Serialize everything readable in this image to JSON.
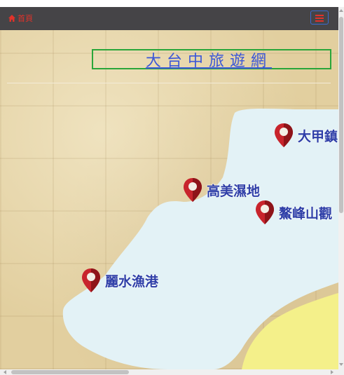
{
  "navbar": {
    "home_label": "首頁",
    "home_icon": "home-icon",
    "menu_icon": "hamburger-menu-icon"
  },
  "header": {
    "title": "大台中旅遊網"
  },
  "map": {
    "colors": {
      "land": "#e2cf9f",
      "sea": "#e3f2f6",
      "island": "#f4f08a",
      "label": "#2f3fa8",
      "pin": "#c8242c"
    },
    "markers": [
      {
        "label": "大甲鎮",
        "icon": "map-pin-icon"
      },
      {
        "label": "高美濕地",
        "icon": "map-pin-icon"
      },
      {
        "label": "鰲峰山觀",
        "icon": "map-pin-icon"
      },
      {
        "label": "麗水漁港",
        "icon": "map-pin-icon"
      }
    ]
  },
  "colors": {
    "navbar_bg": "#454447",
    "accent_red": "#e0322a",
    "title_border": "#2aa63a",
    "title_text": "#3b57d8"
  }
}
